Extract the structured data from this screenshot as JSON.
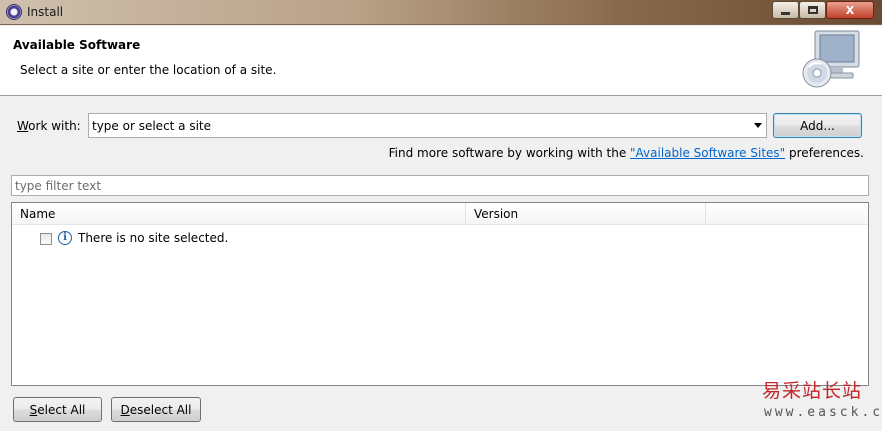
{
  "window": {
    "title": "Install",
    "close_glyph": "X"
  },
  "banner": {
    "title": "Available Software",
    "description": "Select a site or enter the location of a site."
  },
  "work_with": {
    "label_mnemonic": "W",
    "label_rest": "ork with:",
    "value": "type or select a site",
    "add_label": "Add..."
  },
  "find_more": {
    "prefix": "Find more software by working with the ",
    "link": "\"Available Software Sites\"",
    "suffix": " preferences."
  },
  "filter": {
    "placeholder": "type filter text"
  },
  "tree": {
    "columns": [
      "Name",
      "Version"
    ],
    "rows": [
      {
        "icon": "info-icon",
        "text": "There is no site selected.",
        "checked": false
      }
    ]
  },
  "buttons": {
    "select_all_mnemonic": "S",
    "select_all_rest": "elect All",
    "deselect_all_mnemonic": "D",
    "deselect_all_rest": "eselect All"
  },
  "watermark": {
    "logo": "易采站长站",
    "url": "www.easck.com"
  },
  "colors": {
    "link": "#0066cc",
    "close_button": "#c2402a",
    "watermark": "#c0272d"
  }
}
